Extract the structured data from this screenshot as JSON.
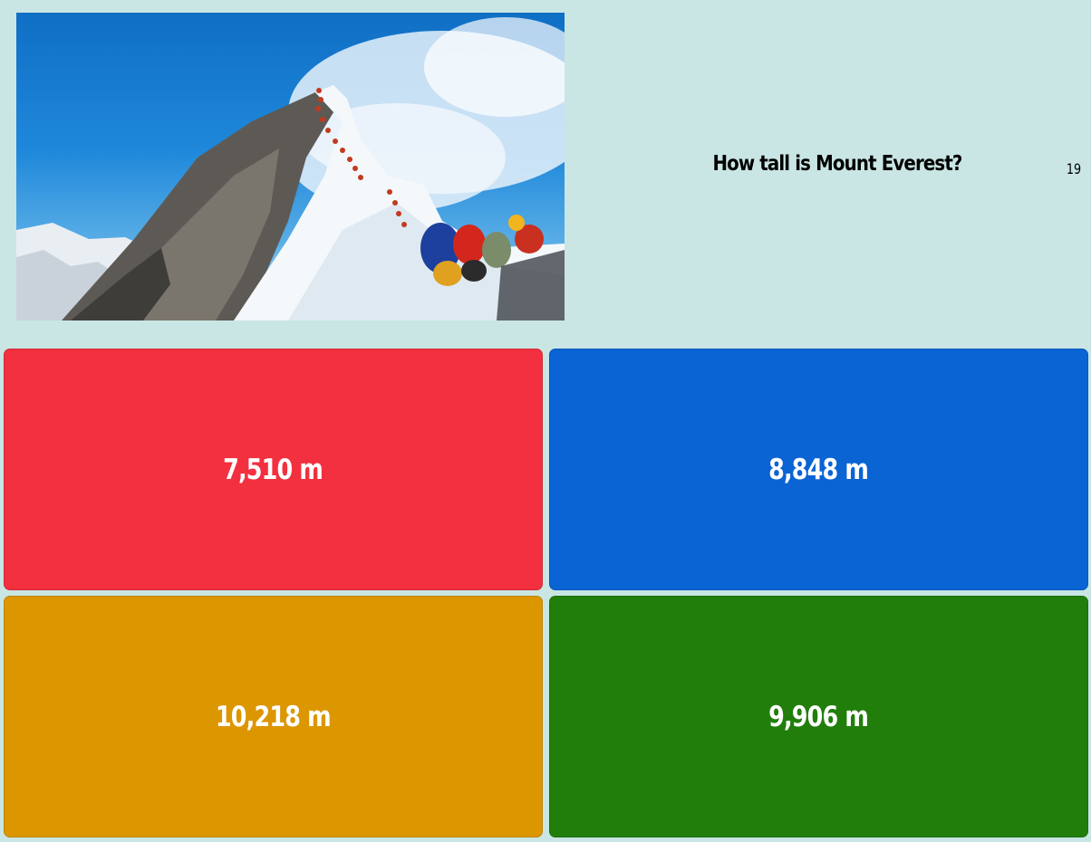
{
  "question": {
    "text": "How tall is Mount Everest?",
    "timer": "19"
  },
  "image": {
    "subject": "climbers-on-everest-summit-ridge"
  },
  "answers": [
    {
      "label": "7,510 m",
      "color": "#f2303f"
    },
    {
      "label": "8,848 m",
      "color": "#0a64d4"
    },
    {
      "label": "10,218 m",
      "color": "#dc9600"
    },
    {
      "label": "9,906 m",
      "color": "#217e0b"
    }
  ],
  "theme": {
    "background": "#c9e6e4"
  }
}
